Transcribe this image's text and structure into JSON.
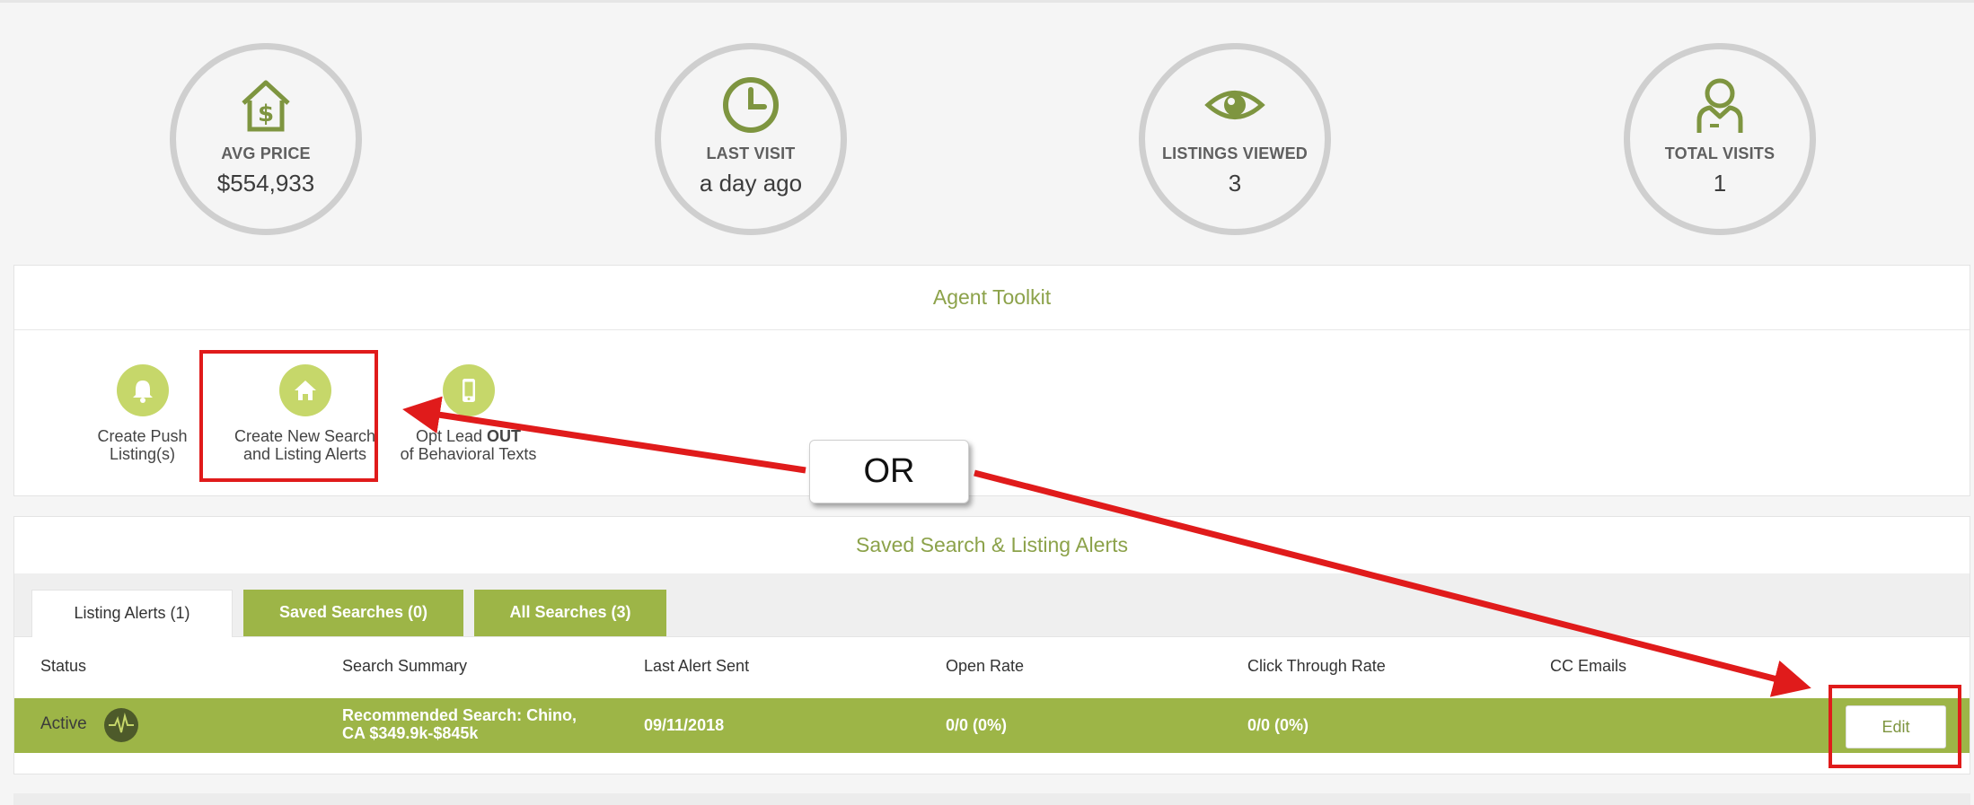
{
  "stats": [
    {
      "label": "AVG PRICE",
      "value": "$554,933",
      "icon": "house-dollar-icon"
    },
    {
      "label": "LAST VISIT",
      "value": "a day ago",
      "icon": "clock-icon"
    },
    {
      "label": "LISTINGS VIEWED",
      "value": "3",
      "icon": "eye-icon"
    },
    {
      "label": "TOTAL VISITS",
      "value": "1",
      "icon": "person-icon"
    }
  ],
  "toolkit": {
    "title": "Agent Toolkit",
    "tools": [
      {
        "line1": "Create Push",
        "line2": "Listing(s)",
        "icon": "bell-icon"
      },
      {
        "line1": "Create New Search",
        "line2": "and Listing Alerts",
        "icon": "home-icon"
      },
      {
        "line1_prefix": "Opt Lead ",
        "line1_bold": "OUT",
        "line2": "of Behavioral Texts",
        "icon": "mobile-phone-icon"
      }
    ]
  },
  "annotation": {
    "or_label": "OR",
    "color": "#e01b1b"
  },
  "alerts": {
    "title": "Saved Search & Listing Alerts",
    "tabs": [
      "Listing Alerts (1)",
      "Saved Searches (0)",
      "All Searches (3)"
    ],
    "columns": [
      "Status",
      "Search Summary",
      "Last Alert Sent",
      "Open Rate",
      "Click Through Rate",
      "CC Emails"
    ],
    "row": {
      "status": "Active",
      "summary_line1": "Recommended Search: Chino,",
      "summary_line2": "CA $349.9k-$845k",
      "last_alert": "09/11/2018",
      "open_rate": "0/0 (0%)",
      "ctr": "0/0 (0%)",
      "edit_label": "Edit"
    }
  },
  "colors": {
    "accent": "#8ca24a",
    "row_green": "#9db547",
    "tool_circle": "#c6d76a",
    "stat_ring": "#cfcfcf"
  }
}
